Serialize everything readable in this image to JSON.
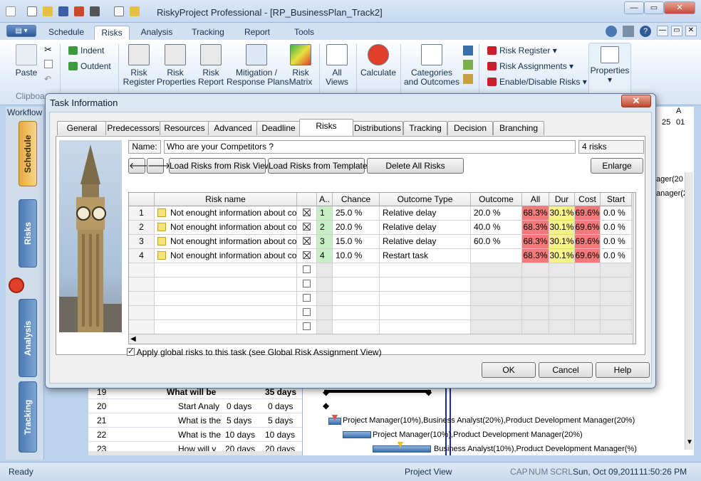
{
  "app": {
    "title": "RiskyProject Professional - [RP_BusinessPlan_Track2]"
  },
  "ribbon": {
    "tabs": [
      "Schedule",
      "Risks",
      "Analysis",
      "Tracking",
      "Report",
      "Tools"
    ],
    "active_tab": "Risks",
    "paste": "Paste",
    "clipboard_group": "Clipboa",
    "indent": "Indent",
    "outdent": "Outdent",
    "risk_register": "Risk\nRegister",
    "risk_properties": "Risk\nProperties",
    "risk_report": "Risk\nReport",
    "mitigation": "Mitigation /\nResponse Plans",
    "risk_matrix": "Risk\nMatrix",
    "all_views": "All\nViews",
    "calculate": "Calculate",
    "categories": "Categories\nand Outcomes",
    "risk_register_menu": "Risk Register",
    "risk_assignments_menu": "Risk Assignments",
    "enable_disable_menu": "Enable/Disable Risks",
    "properties": "Properties"
  },
  "left_nav": {
    "workflow": "Workflow",
    "tabs": [
      "Schedule",
      "Risks",
      "Analysis",
      "Tracking"
    ]
  },
  "background": {
    "rows": [
      {
        "num": "19",
        "name": "What will be",
        "dur": "",
        "dur2": "35 days"
      },
      {
        "num": "20",
        "name": "Start Analy",
        "dur": "0 days",
        "dur2": "0 days"
      },
      {
        "num": "21",
        "name": "What is the",
        "dur": "5 days",
        "dur2": "5 days"
      },
      {
        "num": "22",
        "name": "What is the",
        "dur": "10 days",
        "dur2": "10 days"
      },
      {
        "num": "23",
        "name": "How will y",
        "dur": "20 days",
        "dur2": "20 days"
      }
    ],
    "gantt_labels": [
      "Project Manager(10%),Business Analyst(20%),Product Development Manager(20%)",
      "Project Manager(10%),Product Development Manager(20%)",
      "Business Analyst(10%),Product Development Manager(%)",
      "ager(20",
      "anager(2"
    ],
    "header_snips": [
      "A",
      "25",
      "01",
      "A"
    ]
  },
  "dialog": {
    "title": "Task Information",
    "close": "✕",
    "tabs": [
      "General",
      "Predecessors",
      "Resources",
      "Advanced",
      "Deadline",
      "Risks",
      "Distributions",
      "Tracking",
      "Decision",
      "Branching"
    ],
    "active_tab": "Risks",
    "name_label": "Name:",
    "name_value": "Who are your Competitors ?",
    "risk_count": "4 risks",
    "buttons": {
      "load_view": "Load Risks from Risk View",
      "load_template": "Load Risks from Template",
      "delete_all": "Delete All Risks",
      "enlarge": "Enlarge",
      "ok": "OK",
      "cancel": "Cancel",
      "help": "Help"
    },
    "columns": [
      "",
      "",
      "Risk name",
      "",
      "A..",
      "Chance",
      "Outcome Type",
      "Outcome",
      "All",
      "Dur",
      "Cost",
      "Start"
    ],
    "rows": [
      {
        "num": "1",
        "name": "Not enought information about comp",
        "a": "1",
        "chance": "25.0 %",
        "type": "Relative delay",
        "outcome": "20.0 %",
        "all": "68.3%",
        "dur": "30.1%",
        "cost": "69.6%",
        "start": "0.0 %"
      },
      {
        "num": "2",
        "name": "Not enought information about comp",
        "a": "2",
        "chance": "20.0 %",
        "type": "Relative delay",
        "outcome": "40.0 %",
        "all": "68.3%",
        "dur": "30.1%",
        "cost": "69.6%",
        "start": "0.0 %"
      },
      {
        "num": "3",
        "name": "Not enought information about comp",
        "a": "3",
        "chance": "15.0 %",
        "type": "Relative delay",
        "outcome": "60.0 %",
        "all": "68.3%",
        "dur": "30.1%",
        "cost": "69.6%",
        "start": "0.0 %"
      },
      {
        "num": "4",
        "name": "Not enought information about comp",
        "a": "4",
        "chance": "10.0 %",
        "type": "Restart task",
        "outcome": "",
        "all": "68.3%",
        "dur": "30.1%",
        "cost": "69.6%",
        "start": "0.0 %"
      }
    ],
    "apply_global": "Apply global risks to this task (see Global Risk Assignment View)"
  },
  "status": {
    "ready": "Ready",
    "view": "Project View",
    "cap": "CAP",
    "num": "NUM",
    "scrl": "SCRL",
    "date": "Sun, Oct 09,2011",
    "time": "11:50:26 PM"
  },
  "colors": {
    "all_cell": "#f47a7a",
    "dur_cell": "#f7f28a",
    "cost_cell": "#f47a7a",
    "a_cell": "#c6efc6"
  }
}
